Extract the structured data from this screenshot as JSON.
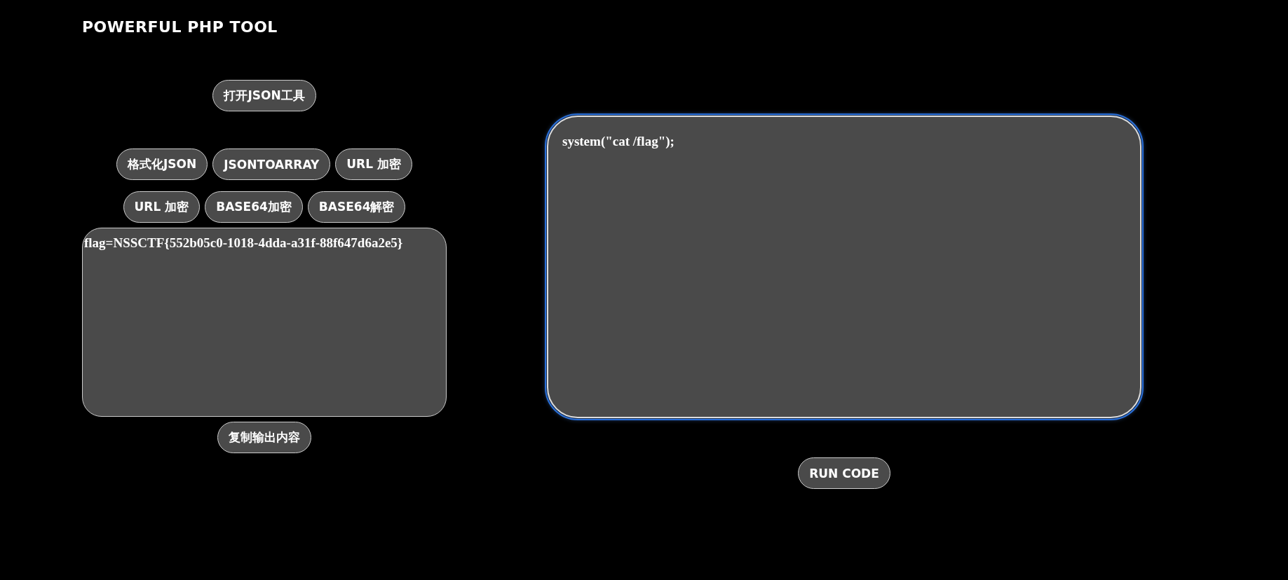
{
  "title": "POWERFUL PHP TOOL",
  "open_json_button": "打开JSON工具",
  "tool_button_rows": [
    [
      "格式化JSON",
      "JSONTOARRAY",
      "URL 加密"
    ],
    [
      "URL 加密",
      "BASE64加密",
      "BASE64解密"
    ]
  ],
  "output": {
    "value": "flag=NSSCTF{552b05c0-1018-4dda-a31f-88f647d6a2e5}"
  },
  "copy_button": "复制输出内容",
  "editor": {
    "value": "system(\"cat /flag\");",
    "focused": true
  },
  "run_button": "RUN CODE"
}
